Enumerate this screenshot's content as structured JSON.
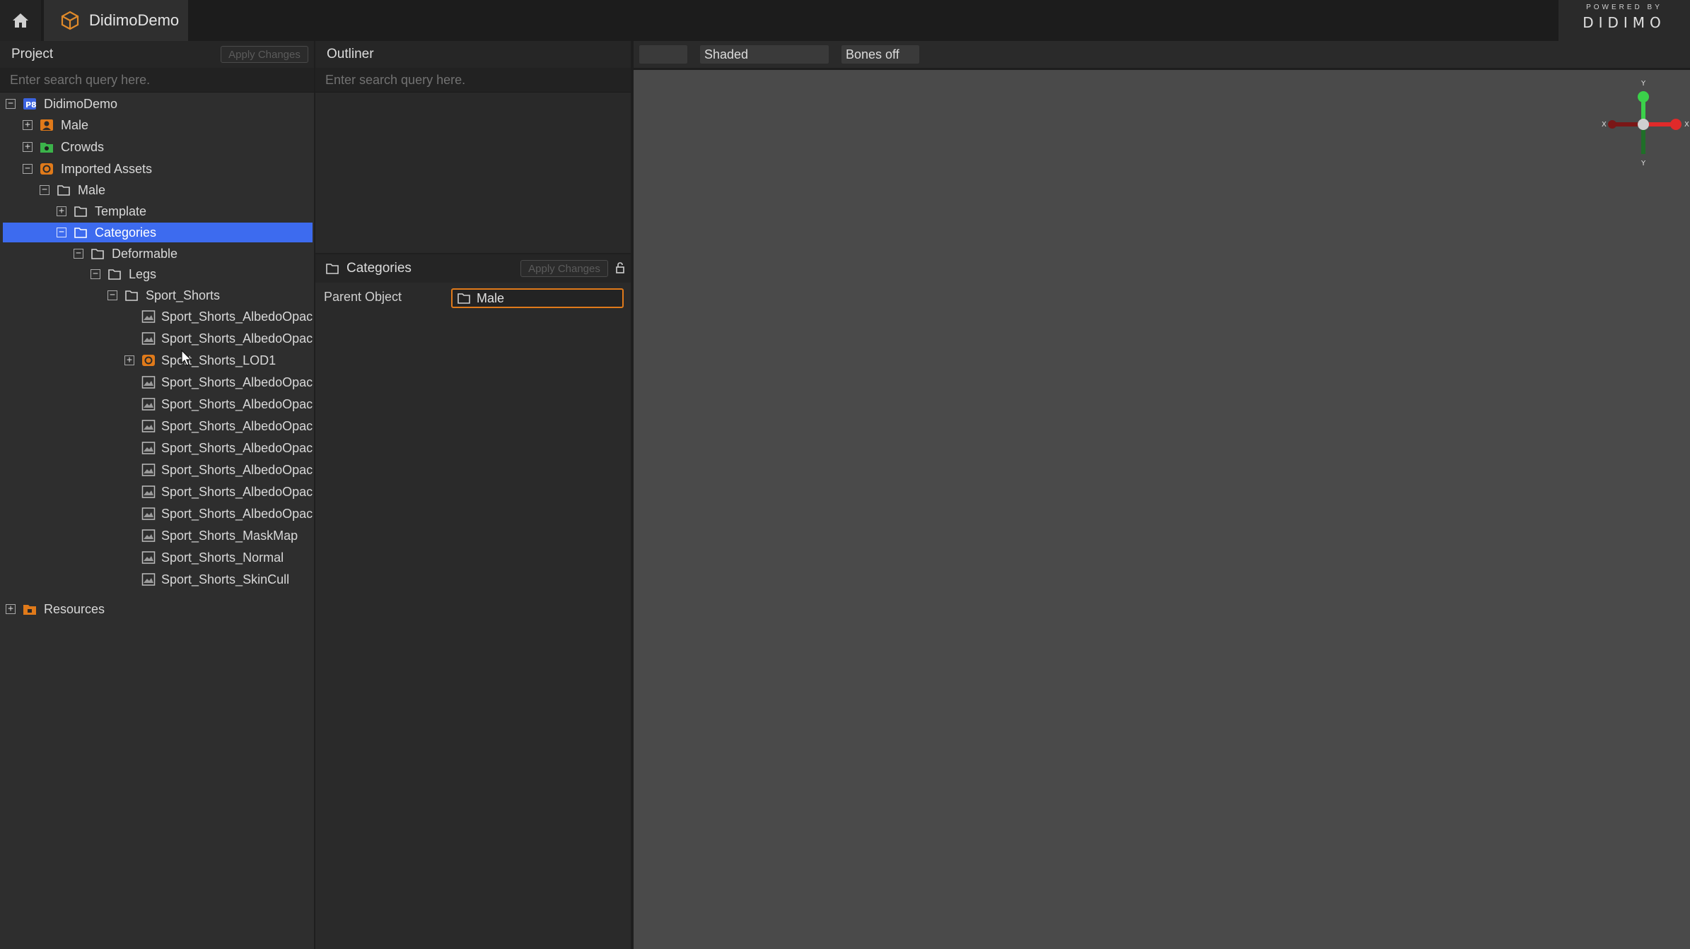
{
  "topbar": {
    "app_tab": "DidimoDemo",
    "brand_line1": "POWERED BY",
    "brand_line2": "DIDIMO"
  },
  "project_panel": {
    "title": "Project",
    "apply_label": "Apply Changes",
    "search_placeholder": "Enter search query here.",
    "tree": {
      "root": "DidimoDemo",
      "male": "Male",
      "crowds": "Crowds",
      "imported_assets": "Imported Assets",
      "imported_male": "Male",
      "template": "Template",
      "categories": "Categories",
      "deformable": "Deformable",
      "legs": "Legs",
      "sport_shorts": "Sport_Shorts",
      "assets": [
        "Sport_Shorts_AlbedoOpac",
        "Sport_Shorts_AlbedoOpac",
        "Sport_Shorts_LOD1",
        "Sport_Shorts_AlbedoOpac",
        "Sport_Shorts_AlbedoOpac",
        "Sport_Shorts_AlbedoOpac",
        "Sport_Shorts_AlbedoOpac",
        "Sport_Shorts_AlbedoOpac",
        "Sport_Shorts_AlbedoOpac",
        "Sport_Shorts_AlbedoOpac",
        "Sport_Shorts_MaskMap",
        "Sport_Shorts_Normal",
        "Sport_Shorts_SkinCull"
      ],
      "resources": "Resources"
    }
  },
  "outliner_panel": {
    "title": "Outliner",
    "search_placeholder": "Enter search query here."
  },
  "inspector": {
    "title": "Categories",
    "apply_label": "Apply Changes",
    "parent_label": "Parent Object",
    "parent_value": "Male"
  },
  "viewport": {
    "mode": "Shaded",
    "bones": "Bones off",
    "axis_y": "Y",
    "axis_x": "X"
  },
  "colors": {
    "selection": "#3d6bef",
    "accent_orange": "#e07a1a",
    "axis_x": "#e02a2a",
    "axis_y": "#3bd14a"
  }
}
